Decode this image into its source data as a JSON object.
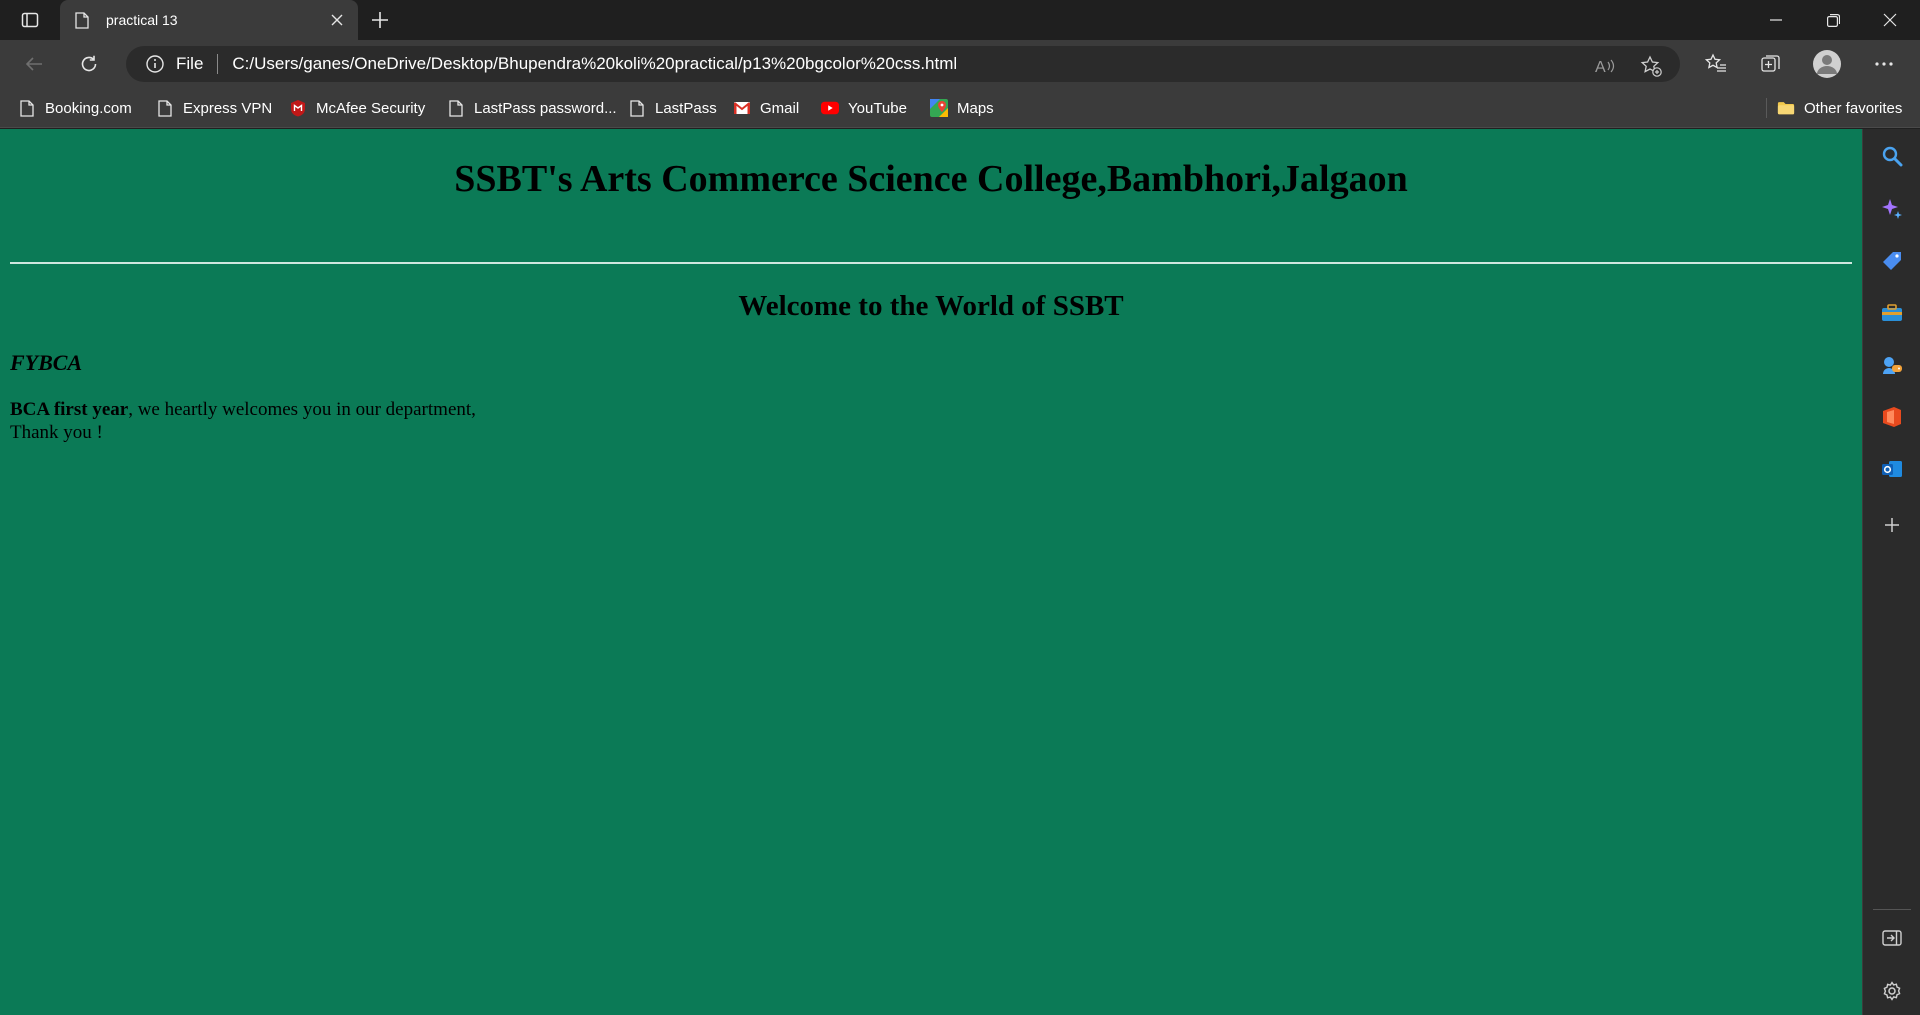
{
  "browser": {
    "tab": {
      "title": "practical 13"
    },
    "address": {
      "scheme": "File",
      "url": "C:/Users/ganes/OneDrive/Desktop/Bhupendra%20koli%20practical/p13%20bgcolor%20css.html"
    },
    "favorites": [
      {
        "label": "Booking.com",
        "icon": "page-icon"
      },
      {
        "label": "Express VPN",
        "icon": "page-icon"
      },
      {
        "label": "McAfee Security",
        "icon": "mcafee-icon"
      },
      {
        "label": "LastPass password...",
        "icon": "page-icon"
      },
      {
        "label": "LastPass",
        "icon": "page-icon"
      },
      {
        "label": "Gmail",
        "icon": "gmail-icon"
      },
      {
        "label": "YouTube",
        "icon": "youtube-icon"
      },
      {
        "label": "Maps",
        "icon": "maps-icon"
      }
    ],
    "other_favorites": "Other favorites"
  },
  "page": {
    "background": "#0b7a56",
    "heading": "SSBT's Arts Commerce Science College,Bambhori,Jalgaon",
    "subheading": "Welcome to the World of SSBT",
    "section": "FYBCA",
    "para_bold": "BCA first year",
    "para_text": ", we heartly welcomes you in our department,",
    "thanks": "Thank you !"
  },
  "colors": {
    "tabstrip": "#1f1f1f",
    "toolbar": "#3b3b3b",
    "omnibox": "#2b2b2b",
    "sidebar": "#2b2b2b"
  }
}
